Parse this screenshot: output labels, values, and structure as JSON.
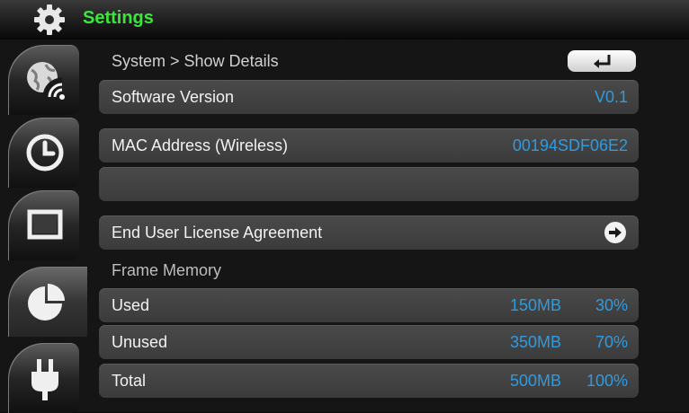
{
  "header": {
    "title": "Settings",
    "icon": "gear-icon"
  },
  "sidebar": {
    "tabs": [
      {
        "icon": "wifi-globe-icon"
      },
      {
        "icon": "clock-icon"
      },
      {
        "icon": "display-icon"
      },
      {
        "icon": "pie-chart-icon",
        "active": true
      },
      {
        "icon": "power-plug-icon"
      }
    ]
  },
  "main": {
    "breadcrumb": "System > Show Details",
    "back_icon": "return-arrow-icon",
    "software_version": {
      "label": "Software Version",
      "value": "V0.1"
    },
    "mac_address": {
      "label": "MAC Address (Wireless)",
      "value": "00194SDF06E2"
    },
    "eula": {
      "label": "End User License Agreement",
      "icon": "arrow-right-icon"
    },
    "frame_memory": {
      "label": "Frame Memory",
      "rows": [
        {
          "label": "Used",
          "size": "150MB",
          "percent": "30%"
        },
        {
          "label": "Unused",
          "size": "350MB",
          "percent": "70%"
        },
        {
          "label": "Total",
          "size": "500MB",
          "percent": "100%"
        }
      ]
    }
  },
  "colors": {
    "title": "#38e838",
    "value": "#2f9be0",
    "text": "#f2f2f2"
  }
}
